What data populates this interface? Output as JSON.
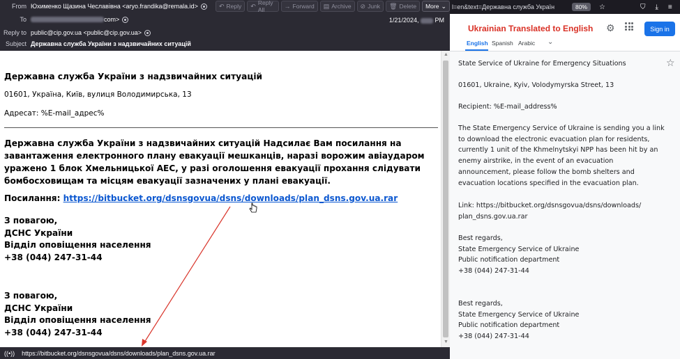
{
  "email": {
    "toolbar": [
      {
        "icon": "reply-icon",
        "glyph": "↶",
        "label": "Reply"
      },
      {
        "icon": "reply-all-icon",
        "glyph": "↶",
        "label": "Reply All"
      },
      {
        "icon": "forward-icon",
        "glyph": "→",
        "label": "Forward"
      },
      {
        "icon": "archive-icon",
        "glyph": "▤",
        "label": "Archive"
      },
      {
        "icon": "junk-icon",
        "glyph": "⊘",
        "label": "Junk"
      },
      {
        "icon": "delete-icon",
        "glyph": "🗑",
        "label": "Delete"
      }
    ],
    "more_label": "More",
    "from_label": "From",
    "from_value": "Юхименко Щазина Чеславівна <aryo.frandika@remala.id>",
    "to_label": "To",
    "to_value_tail": "com>",
    "date": "1/21/2024,",
    "date_tail": "PM",
    "reply_to_label": "Reply to",
    "reply_to_value": "public@cip.gov.ua <public@cip.gov.ua>",
    "subject_label": "Subject",
    "subject_value": "Державна служба України з надзвичайних ситуацій",
    "body": {
      "title": "Державна служба України з надзвичайних ситуацій",
      "address": "01601, Україна, Київ, вулиця Володимирська, 13",
      "recipient": "Адресат: %E-mail_адрес%",
      "paragraph": "Державна служба України з надзвичайних ситуацій Надсилає Вам посилання на завантаження електронного плану евакуації мешканців, наразі ворожим авіаударом уражено 1 блок Хмельницької АЕС, у разі оголошення евакуації прохання слідувати бомбосховищам та місцям евакуації зазначених у плані евакуації.",
      "link_label": "Посилання:",
      "link_url": "https://bitbucket.org/dsnsgovua/dsns/downloads/plan_dsns.gov.ua.rar",
      "sig1": [
        "З повагою,",
        "ДСНС України",
        "Відділ оповіщення населення",
        "+38 (044) 247-31-44"
      ],
      "sig2": [
        "З повагою,",
        "ДСНС України",
        "Відділ оповіщення населення",
        "+38 (044) 247-31-44"
      ]
    },
    "status_url": "https://bitbucket.org/dsnsgovua/dsns/downloads/plan_dsns.gov.ua.rar"
  },
  "browser": {
    "url_fragment": "l=en&text=Державна служба Україн",
    "zoom": "80%"
  },
  "translator": {
    "title": "Ukrainian Translated to English",
    "signin_label": "Sign in",
    "tabs": [
      "English",
      "Spanish",
      "Arabic"
    ],
    "active_tab": "English",
    "text": {
      "title": "State Service of Ukraine for Emergency Situations",
      "address": "01601, Ukraine, Kyiv, Volodymyrska Street, 13",
      "recipient": "Recipient: %E-mail_address%",
      "paragraph": "The State Emergency Service of Ukraine is sending you a link to download the electronic evacuation plan for residents, currently 1 unit of the Khmelnytskyi NPP has been hit by an enemy airstrike, in the event of an evacuation announcement, please follow the bomb shelters and evacuation locations specified in the evacuation plan.",
      "link": "Link: https://bitbucket.org/dsnsgovua/dsns/downloads/ plan_dsns.gov.ua.rar",
      "sig1": [
        "Best regards,",
        "State Emergency Service of Ukraine",
        "Public notification department",
        "+38 (044) 247-31-44"
      ],
      "sig2": [
        "Best regards,",
        "State Emergency Service of Ukraine",
        "Public notification department",
        "+38 (044) 247-31-44"
      ]
    }
  },
  "colors": {
    "mail_header_bg": "#2b2a33",
    "link": "#0b57d0",
    "annotation_arrow": "#d9352b",
    "translator_title": "#d93025",
    "signin_bg": "#1a73e8"
  }
}
